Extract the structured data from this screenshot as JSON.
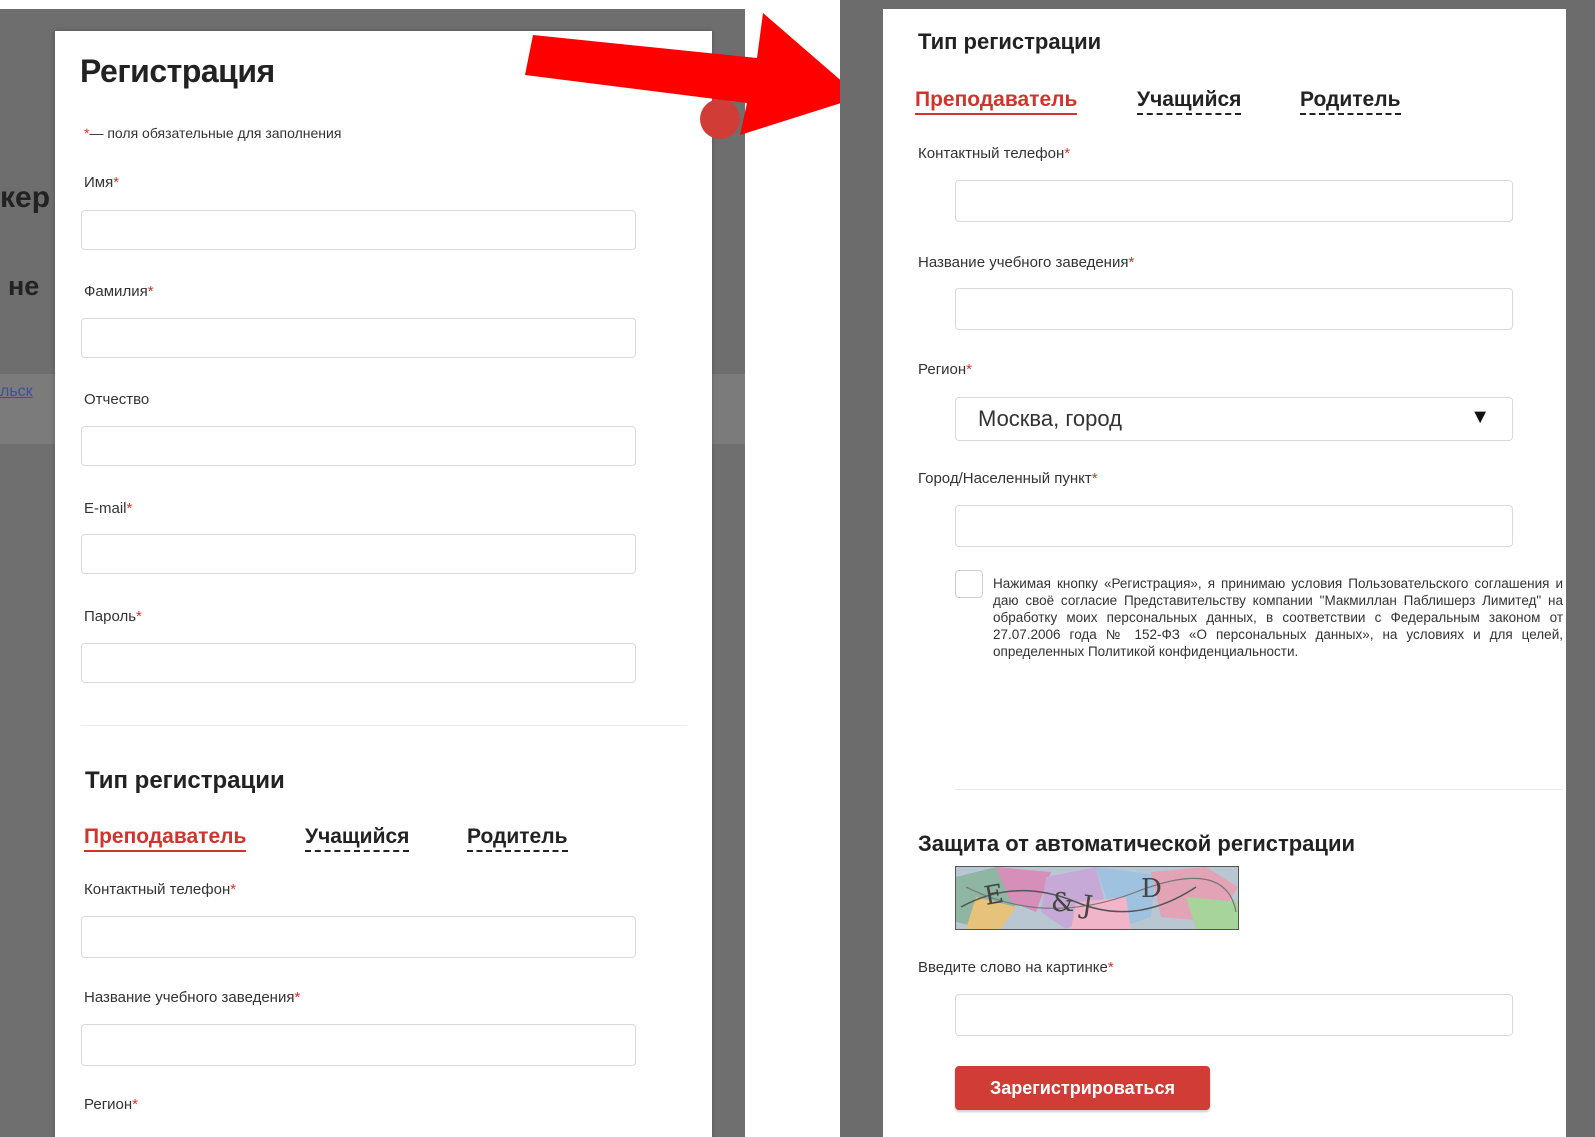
{
  "background": {
    "heading_fragment": "кер",
    "subheading_fragment": "не",
    "link_fragment": "льск"
  },
  "left": {
    "title": "Регистрация",
    "required_note_star": "*",
    "required_note": "— поля обязательные для заполнения",
    "fields": {
      "first_name": "Имя",
      "last_name": "Фамилия",
      "patronymic": "Отчество",
      "email": "E-mail",
      "password": "Пароль",
      "phone": "Контактный телефон",
      "school": "Название учебного заведения",
      "region": "Регион"
    },
    "registration_type_title": "Тип регистрации",
    "tabs": [
      "Преподаватель",
      "Учащийся",
      "Родитель"
    ]
  },
  "right": {
    "registration_type_title": "Тип регистрации",
    "tabs": [
      "Преподаватель",
      "Учащийся",
      "Родитель"
    ],
    "fields": {
      "phone": "Контактный телефон",
      "school": "Название учебного заведения",
      "region": "Регион",
      "city": "Город/Населенный пункт",
      "captcha_input": "Введите слово на картинке"
    },
    "region_value": "Москва, город",
    "consent_text": "Нажимая кнопку «Регистрация», я принимаю условия Пользовательского соглашения и даю своё согласие Представительству компании \"Макмиллан Паблишерз Лимитед\" на обработку моих персональных данных, в соответствии с Федеральным законом от 27.07.2006 года № 152-ФЗ «О персональных данных», на условиях и для целей, определенных Политикой конфиденциальности.",
    "captcha_title": "Защита от автоматической регистрации",
    "submit_label": "Зарегистрироваться"
  },
  "required_star": "*",
  "colors": {
    "accent": "#d0342c",
    "arrow": "#ff0000",
    "overlay": "#6f6f6f"
  },
  "icons": {
    "select_arrow": "triangle-down-icon",
    "close": "close-icon",
    "arrow": "red-arrow-icon"
  }
}
